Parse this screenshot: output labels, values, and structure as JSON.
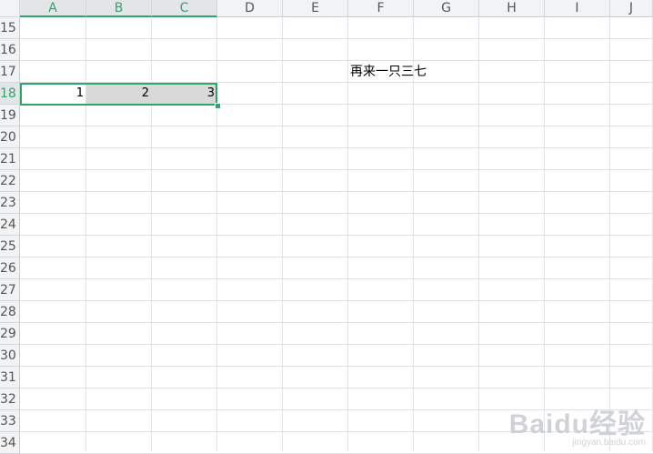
{
  "columns": [
    "A",
    "B",
    "C",
    "D",
    "E",
    "F",
    "G",
    "H",
    "I",
    "J"
  ],
  "selected_columns": [
    "A",
    "B",
    "C"
  ],
  "rows": [
    "15",
    "16",
    "17",
    "18",
    "19",
    "20",
    "21",
    "22",
    "23",
    "24",
    "25",
    "26",
    "27",
    "28",
    "29",
    "30",
    "31",
    "32",
    "33",
    "34"
  ],
  "selected_row": "18",
  "cells": {
    "A18": "1",
    "B18": "2",
    "C18": "3",
    "F17": "再来一只三七"
  },
  "colors": {
    "selection_accent": "#2ea66a",
    "selection_fill": "#d9d9d9",
    "gridline": "#dfe2e6",
    "header_bg": "#f2f3f5"
  },
  "watermark": {
    "logo": "Baidu经验",
    "url": "jingyan.baidu.com"
  }
}
